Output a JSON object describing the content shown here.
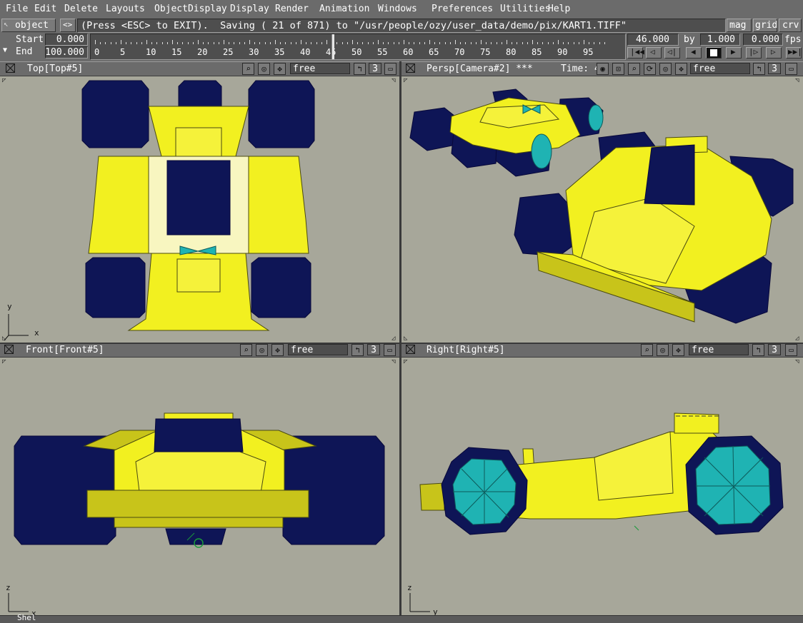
{
  "menubar": {
    "items": [
      "File",
      "Edit",
      "Delete",
      "Layouts",
      "ObjectDisplay",
      "Display",
      "Render",
      "Animation",
      "Windows",
      "Preferences",
      "Utilities",
      "Help"
    ]
  },
  "toolbar": {
    "mode_label": "object",
    "swap_label": "<>",
    "message": "(Press <ESC> to EXIT).  Saving ( 21 of 871) to \"/usr/people/ozy/user_data/demo/pix/KART1.TIFF\"",
    "mag_label": "mag",
    "grid_label": "grid",
    "crv_label": "crv"
  },
  "timeline": {
    "start_label": "Start",
    "end_label": "End",
    "start_value": "0.000",
    "end_value": "100.000",
    "ticks": [
      "0",
      "5",
      "10",
      "15",
      "20",
      "25",
      "30",
      "35",
      "40",
      "45",
      "50",
      "55",
      "60",
      "65",
      "70",
      "75",
      "80",
      "85",
      "90",
      "95"
    ],
    "current_frame": "46.000",
    "by_label": "by",
    "by_value": "1.000",
    "fps_value": "0.000",
    "fps_label": "fps",
    "current_fraction": 0.46
  },
  "viewports": {
    "top": {
      "title": "Top[Top#5]",
      "mode": "free",
      "level": "3",
      "axis_v": "y",
      "axis_h": "x"
    },
    "persp": {
      "title": "Persp[Camera#2] ***",
      "time": "Time: 4",
      "mode": "free",
      "level": "3"
    },
    "front": {
      "title": "Front[Front#5]",
      "mode": "free",
      "level": "3",
      "axis_v": "z",
      "axis_h": "x"
    },
    "right": {
      "title": "Right[Right#5]",
      "mode": "free",
      "level": "3",
      "axis_v": "z",
      "axis_h": "y"
    }
  },
  "colors": {
    "wheel": "#0e1556",
    "body": "#f2f020",
    "body_shade": "#c8c41a",
    "hub": "#1fb3b3",
    "viewport_bg": "#a7a79a",
    "chrome": "#6b6b6b"
  },
  "status": {
    "text": "Shel"
  }
}
